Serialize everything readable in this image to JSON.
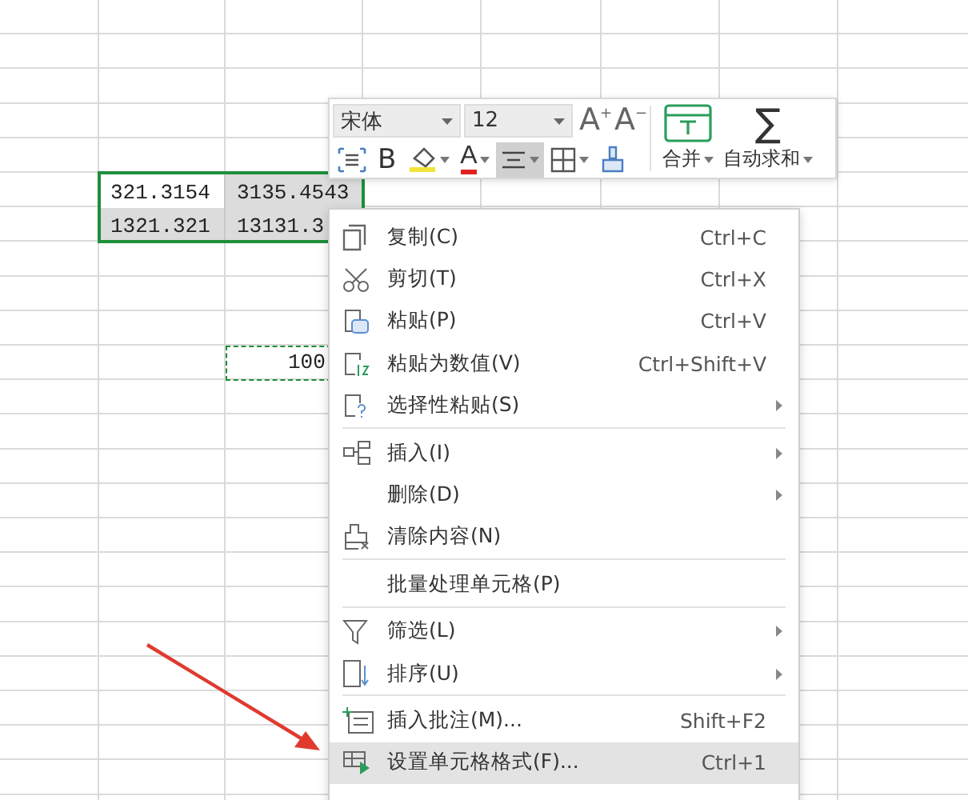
{
  "sheet": {
    "selection": {
      "rows": [
        [
          {
            "text": "321.3154",
            "active": true
          },
          {
            "text": "3135.4543",
            "active": false
          }
        ],
        [
          {
            "text": "1321.321",
            "active": false
          },
          {
            "text": "13131.3",
            "active": false
          }
        ]
      ]
    },
    "copied_cell": {
      "text": "100"
    }
  },
  "toolbar": {
    "font": "宋体",
    "size": "12",
    "grow": "A",
    "grow_sign": "+",
    "shrink": "A",
    "shrink_sign": "−",
    "buttons": [
      {
        "kind": "wrap",
        "selected": false
      },
      {
        "kind": "bold",
        "label": "B",
        "selected": false
      },
      {
        "kind": "fill",
        "selected": false
      },
      {
        "kind": "font-color",
        "label": "A",
        "selected": false
      },
      {
        "kind": "align",
        "selected": true
      },
      {
        "kind": "borders",
        "selected": false
      },
      {
        "kind": "painter",
        "selected": false
      }
    ],
    "merge": "合并",
    "sum_symbol": "∑",
    "sum": "自动求和"
  },
  "context_menu": {
    "items": [
      {
        "kind": "copy",
        "label": "复制(C)",
        "shortcut": "Ctrl+C",
        "submenu": false,
        "separator_before": false,
        "selected": false
      },
      {
        "kind": "cut",
        "label": "剪切(T)",
        "shortcut": "Ctrl+X",
        "submenu": false,
        "separator_before": false,
        "selected": false
      },
      {
        "kind": "paste",
        "label": "粘贴(P)",
        "shortcut": "Ctrl+V",
        "submenu": false,
        "separator_before": false,
        "selected": false
      },
      {
        "kind": "paste-values",
        "label": "粘贴为数值(V)",
        "shortcut": "Ctrl+Shift+V",
        "submenu": false,
        "separator_before": false,
        "selected": false
      },
      {
        "kind": "paste-special",
        "label": "选择性粘贴(S)",
        "submenu": true,
        "separator_before": false,
        "selected": false
      },
      {
        "kind": "insert",
        "label": "插入(I)",
        "submenu": true,
        "separator_before": true,
        "selected": false
      },
      {
        "kind": "delete",
        "label": "删除(D)",
        "submenu": true,
        "separator_before": false,
        "selected": false
      },
      {
        "kind": "clear",
        "label": "清除内容(N)",
        "submenu": false,
        "separator_before": false,
        "selected": false
      },
      {
        "kind": "batch",
        "label": "批量处理单元格(P)",
        "submenu": false,
        "separator_before": true,
        "selected": false
      },
      {
        "kind": "filter",
        "label": "筛选(L)",
        "submenu": true,
        "separator_before": true,
        "selected": false
      },
      {
        "kind": "sort",
        "label": "排序(U)",
        "submenu": true,
        "separator_before": false,
        "selected": false
      },
      {
        "kind": "comment",
        "label": "插入批注(M)...",
        "shortcut": "Shift+F2",
        "submenu": false,
        "separator_before": true,
        "selected": false
      },
      {
        "kind": "format",
        "label": "设置单元格格式(F)...",
        "shortcut": "Ctrl+1",
        "submenu": false,
        "separator_before": false,
        "selected": true
      }
    ]
  }
}
